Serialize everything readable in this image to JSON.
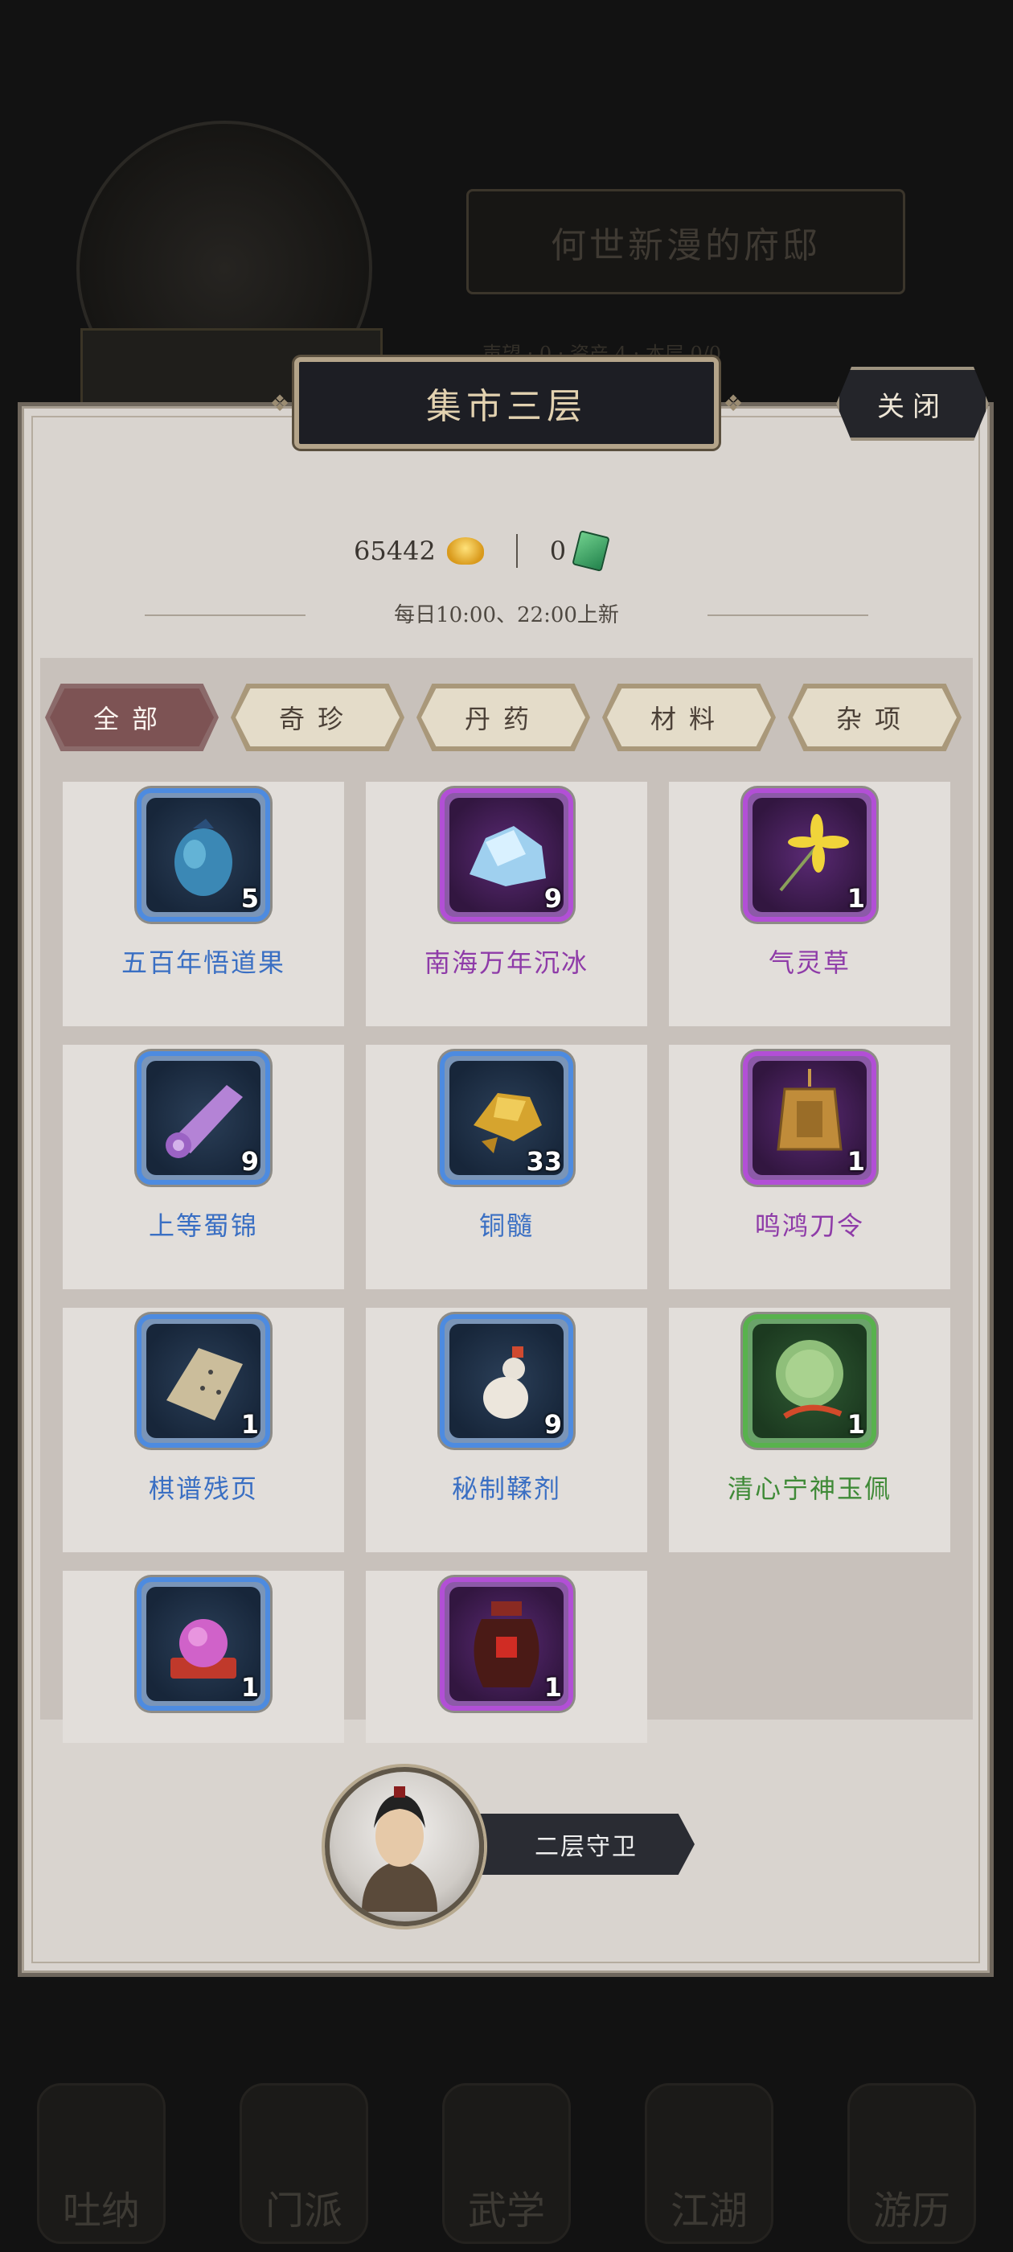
{
  "background": {
    "mansion_title": "何世新漫的府邸",
    "mansion_stats": "声望 · 0 · 资产 4 · 本层 0/0",
    "nav_items": [
      "吐纳",
      "门派",
      "武学",
      "江湖",
      "游历"
    ]
  },
  "header": {
    "title": "集市三层",
    "close_label": "关闭"
  },
  "currency": {
    "gold_amount": "65442",
    "jade_amount": "0"
  },
  "refresh_text": "每日10:00、22:00上新",
  "tabs": [
    {
      "label": "全部",
      "active": true
    },
    {
      "label": "奇珍",
      "active": false
    },
    {
      "label": "丹药",
      "active": false
    },
    {
      "label": "材料",
      "active": false
    },
    {
      "label": "杂项",
      "active": false
    }
  ],
  "items": [
    {
      "name": "五百年悟道果",
      "qty": "5",
      "rarity": "blue",
      "icon": "fruit-pouch-icon"
    },
    {
      "name": "南海万年沉冰",
      "qty": "9",
      "rarity": "purple",
      "icon": "ice-crystal-icon"
    },
    {
      "name": "气灵草",
      "qty": "1",
      "rarity": "purple",
      "icon": "herb-flower-icon"
    },
    {
      "name": "上等蜀锦",
      "qty": "9",
      "rarity": "blue",
      "icon": "silk-roll-icon"
    },
    {
      "name": "铜髓",
      "qty": "33",
      "rarity": "blue",
      "icon": "copper-ore-icon"
    },
    {
      "name": "鸣鸿刀令",
      "qty": "1",
      "rarity": "purple",
      "icon": "token-plaque-icon"
    },
    {
      "name": "棋谱残页",
      "qty": "1",
      "rarity": "blue",
      "icon": "torn-page-icon"
    },
    {
      "name": "秘制鞣剂",
      "qty": "9",
      "rarity": "blue",
      "icon": "gourd-bottle-icon"
    },
    {
      "name": "清心宁神玉佩",
      "qty": "1",
      "rarity": "green",
      "icon": "jade-pendant-icon"
    },
    {
      "name": "",
      "qty": "1",
      "rarity": "blue",
      "icon": "yarn-ball-icon"
    },
    {
      "name": "",
      "qty": "1",
      "rarity": "purple",
      "icon": "wine-jar-icon"
    }
  ],
  "guard": {
    "label": "二层守卫"
  },
  "colors": {
    "panel_bg": "#d9d4cf",
    "blue_rarity": "#3a6fc3",
    "purple_rarity": "#8e3ba8",
    "green_rarity": "#3f8a37",
    "active_tab": "#7d5354"
  }
}
